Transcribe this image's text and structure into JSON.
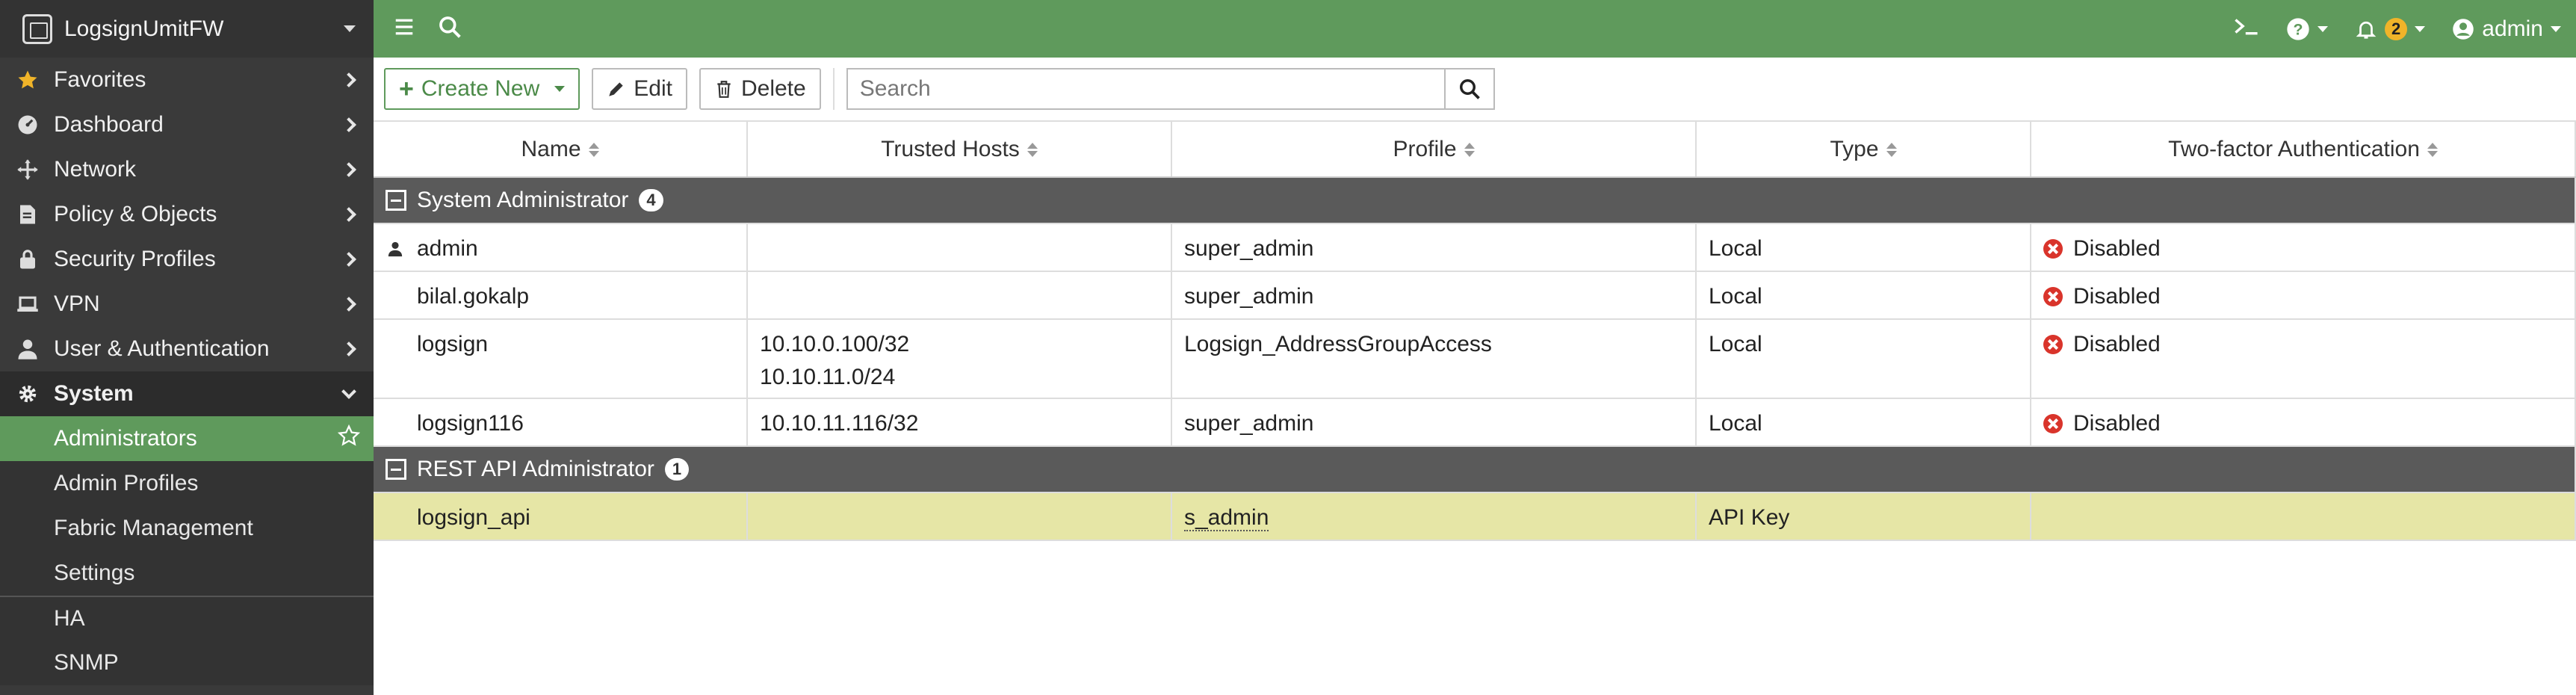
{
  "sidebar": {
    "device_name": "LogsignUmitFW",
    "items": [
      {
        "label": "Favorites",
        "icon": "star-icon"
      },
      {
        "label": "Dashboard",
        "icon": "dashboard-icon"
      },
      {
        "label": "Network",
        "icon": "network-icon"
      },
      {
        "label": "Policy & Objects",
        "icon": "policy-icon"
      },
      {
        "label": "Security Profiles",
        "icon": "lock-icon"
      },
      {
        "label": "VPN",
        "icon": "laptop-icon"
      },
      {
        "label": "User & Authentication",
        "icon": "user-icon"
      },
      {
        "label": "System",
        "icon": "gear-icon"
      }
    ],
    "sub_items": [
      {
        "label": "Administrators"
      },
      {
        "label": "Admin Profiles"
      },
      {
        "label": "Fabric Management"
      },
      {
        "label": "Settings"
      },
      {
        "label": "HA"
      },
      {
        "label": "SNMP"
      }
    ]
  },
  "topbar": {
    "notification_count": "2",
    "user": "admin"
  },
  "toolbar": {
    "create_label": "Create New",
    "edit_label": "Edit",
    "delete_label": "Delete",
    "search_placeholder": "Search"
  },
  "table": {
    "columns": [
      "Name",
      "Trusted Hosts",
      "Profile",
      "Type",
      "Two-factor Authentication"
    ],
    "groups": [
      {
        "label": "System Administrator",
        "count": "4",
        "rows": [
          {
            "name": "admin",
            "hosts": [
              "",
              ""
            ],
            "profile": "super_admin",
            "type": "Local",
            "twofa": "Disabled"
          },
          {
            "name": "bilal.gokalp",
            "hosts": [
              "",
              ""
            ],
            "profile": "super_admin",
            "type": "Local",
            "twofa": "Disabled"
          },
          {
            "name": "logsign",
            "hosts": [
              "10.10.0.100/32",
              "10.10.11.0/24"
            ],
            "profile": "Logsign_AddressGroupAccess",
            "type": "Local",
            "twofa": "Disabled"
          },
          {
            "name": "logsign116",
            "hosts": [
              "10.10.11.116/32",
              ""
            ],
            "profile": "super_admin",
            "type": "Local",
            "twofa": "Disabled"
          }
        ]
      },
      {
        "label": "REST API Administrator",
        "count": "1",
        "rows": [
          {
            "name": "logsign_api",
            "hosts": [
              "",
              ""
            ],
            "profile": "s_admin",
            "type": "API Key",
            "twofa": ""
          }
        ]
      }
    ]
  },
  "colors": {
    "accent_green": "#5f9a5c",
    "sidebar_bg": "#3a3a3a",
    "selected_row": "#e6e6a6",
    "disabled_red": "#d9342b",
    "badge_yellow": "#f0b429"
  }
}
